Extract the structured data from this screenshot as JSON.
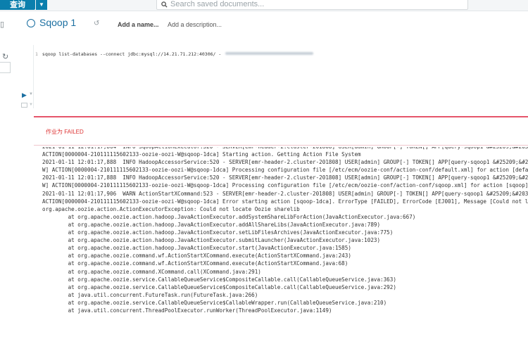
{
  "topbar": {
    "query_label": "查询",
    "search_placeholder": "Search saved documents..."
  },
  "document": {
    "title": "Sqoop 1",
    "add_name": "Add a name...",
    "add_description": "Add a description..."
  },
  "editor": {
    "line_number": "1",
    "code": "sqoop list-databases --connect jdbc:mysql://14.21.71.212:40306/ -"
  },
  "status": {
    "text": "作业为 FAILED",
    "color": "#dd3333"
  },
  "log_lines": [
    "2021-01-11 12:01:17,864  INFO SqoopActionExecutor:520 - SERVER[emr-header-2.cluster-201808] USER[admin] GROUP[-] TOKEN[] APP[query-sqoop1 &#25209;&#2031",
    "ACTION[0000004-210111115602133-oozie-oozi-W@sqoop-1dca] Starting action. Getting Action File System",
    "2021-01-11 12:01:17,888  INFO HadoopAccessorService:520 - SERVER[emr-header-2.cluster-201808] USER[admin] GROUP[-] TOKEN[] APP[query-sqoop1 &#25209;&#20",
    "W] ACTION[0000004-210111115602133-oozie-oozi-W@sqoop-1dca] Processing configuration file [/etc/ecm/oozie-conf/action-conf/default.xml] for action [defau",
    "2021-01-11 12:01:17,888  INFO HadoopAccessorService:520 - SERVER[emr-header-2.cluster-201808] USER[admin] GROUP[-] TOKEN[] APP[query-sqoop1 &#25209;&#20",
    "W] ACTION[0000004-210111115602133-oozie-oozi-W@sqoop-1dca] Processing configuration file [/etc/ecm/oozie-conf/action-conf/sqoop.xml] for action [sqoop]",
    "2021-01-11 12:01:17,906  WARN ActionStartXCommand:523 - SERVER[emr-header-2.cluster-201808] USER[admin] GROUP[-] TOKEN[] APP[query-sqoop1 &#25209;&#2031",
    "ACTION[0000004-210111115602133-oozie-oozi-W@sqoop-1dca] Error starting action [sqoop-1dca]. ErrorType [FAILED], ErrorCode [EJ001], Message [Could not lo",
    "org.apache.oozie.action.ActionExecutorException: Could not locate Oozie sharelib",
    "        at org.apache.oozie.action.hadoop.JavaActionExecutor.addSystemShareLibForAction(JavaActionExecutor.java:667)",
    "        at org.apache.oozie.action.hadoop.JavaActionExecutor.addAllShareLibs(JavaActionExecutor.java:789)",
    "        at org.apache.oozie.action.hadoop.JavaActionExecutor.setLibFilesArchives(JavaActionExecutor.java:775)",
    "        at org.apache.oozie.action.hadoop.JavaActionExecutor.submitLauncher(JavaActionExecutor.java:1023)",
    "        at org.apache.oozie.action.hadoop.JavaActionExecutor.start(JavaActionExecutor.java:1585)",
    "        at org.apache.oozie.command.wf.ActionStartXCommand.execute(ActionStartXCommand.java:243)",
    "        at org.apache.oozie.command.wf.ActionStartXCommand.execute(ActionStartXCommand.java:68)",
    "        at org.apache.oozie.command.XCommand.call(XCommand.java:291)",
    "        at org.apache.oozie.service.CallableQueueService$CompositeCallable.call(CallableQueueService.java:363)",
    "        at org.apache.oozie.service.CallableQueueService$CompositeCallable.call(CallableQueueService.java:292)",
    "        at java.util.concurrent.FutureTask.run(FutureTask.java:266)",
    "        at org.apache.oozie.service.CallableQueueService$CallableWrapper.run(CallableQueueService.java:210)",
    "        at java.util.concurrent.ThreadPoolExecutor.runWorker(ThreadPoolExecutor.java:1149)"
  ]
}
